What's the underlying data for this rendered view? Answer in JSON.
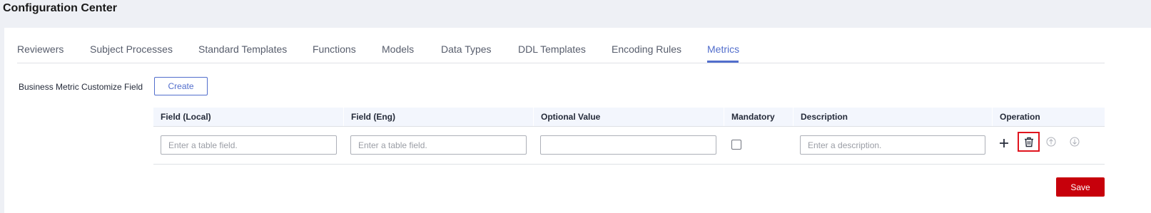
{
  "page": {
    "title": "Configuration Center"
  },
  "tabs": [
    {
      "label": "Reviewers"
    },
    {
      "label": "Subject Processes"
    },
    {
      "label": "Standard Templates"
    },
    {
      "label": "Functions"
    },
    {
      "label": "Models"
    },
    {
      "label": "Data Types"
    },
    {
      "label": "DDL Templates"
    },
    {
      "label": "Encoding Rules"
    },
    {
      "label": "Metrics",
      "active": true
    }
  ],
  "section": {
    "label": "Business Metric Customize Field",
    "create_label": "Create"
  },
  "table": {
    "columns": [
      "Field (Local)",
      "Field (Eng)",
      "Optional Value",
      "Mandatory",
      "Description",
      "Operation"
    ],
    "row": {
      "field_local": {
        "value": "",
        "placeholder": "Enter a table field."
      },
      "field_eng": {
        "value": "",
        "placeholder": "Enter a table field."
      },
      "optional_value": {
        "value": "",
        "placeholder": ""
      },
      "mandatory": false,
      "description": {
        "value": "",
        "placeholder": "Enter a description."
      },
      "operations": [
        "plus-icon",
        "trash-icon",
        "arrow-up-circle-icon",
        "arrow-down-circle-icon"
      ]
    }
  },
  "footer": {
    "save_label": "Save"
  },
  "colors": {
    "accent": "#526ecc",
    "danger": "#c7000b",
    "highlight_border": "#e0141e",
    "header_bg": "#f3f6fd",
    "page_bg": "#eef0f5"
  }
}
